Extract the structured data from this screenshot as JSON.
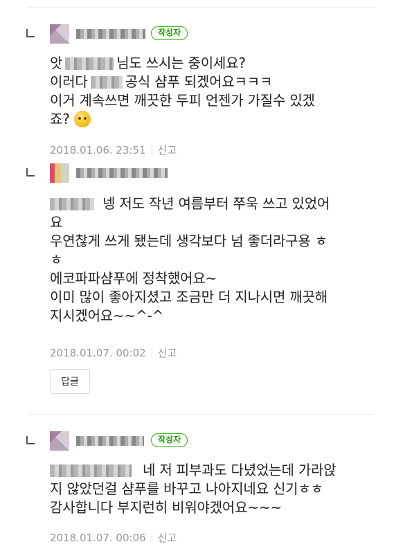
{
  "comments": [
    {
      "author_badge": "작성자",
      "lines": [
        {
          "pre": "앗",
          "post": "님도 쓰시는 중이세요?"
        },
        {
          "pre": "이러다",
          "post": "공식 샴푸 되겠어요ㅋㅋㅋ"
        },
        {
          "pre": "이거 계속쓰면 깨끗한 두피 언젠가 가질수 있겠",
          "post": ""
        },
        {
          "pre": "죠?",
          "post": ""
        }
      ],
      "date": "2018.01.06. 23:51",
      "report_label": "신고"
    },
    {
      "lines": [
        {
          "pre": "",
          "post": "넹 저도 작년 여름부터 쭈욱 쓰고 있었어"
        },
        {
          "pre": "요",
          "post": ""
        },
        {
          "pre": "우연찮게 쓰게 됐는데 생각보다 넘 좋더라구용 ㅎ",
          "post": ""
        },
        {
          "pre": "ㅎ",
          "post": ""
        },
        {
          "pre": "에코파파샴푸에 정착했어요~",
          "post": ""
        },
        {
          "pre": "이미 많이 좋아지셨고 조금만 더 지나시면 깨끗해",
          "post": ""
        },
        {
          "pre": "지시겠어요~~^-^",
          "post": ""
        }
      ],
      "date": "2018.01.07. 00:02",
      "report_label": "신고",
      "reply_button": "답글"
    },
    {
      "author_badge": "작성자",
      "lines": [
        {
          "pre": "",
          "post": "네 저 피부과도 다녔었는데 가라앉"
        },
        {
          "pre": "지 않았던걸 샴푸를 바꾸고 나아지네요 신기ㅎㅎ",
          "post": ""
        },
        {
          "pre": "감사합니다 부지런히 비워야겠어요~~~",
          "post": ""
        }
      ],
      "date": "2018.01.07. 00:06",
      "report_label": "신고"
    }
  ]
}
